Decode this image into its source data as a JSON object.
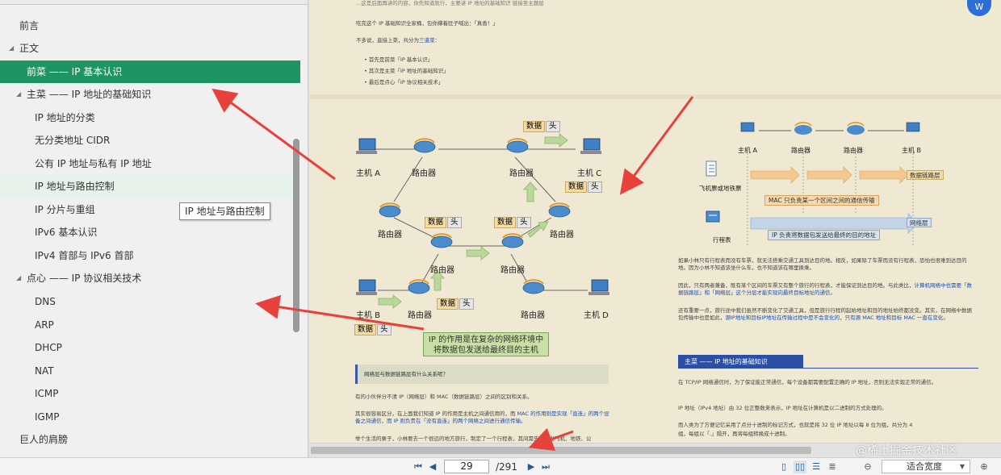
{
  "toc": {
    "items": [
      {
        "label": "前言",
        "level": 0,
        "expanded": null
      },
      {
        "label": "正文",
        "level": 0,
        "expanded": true
      },
      {
        "label": "前菜 —— IP 基本认识",
        "level": 1,
        "expanded": null,
        "active": true
      },
      {
        "label": "主菜 —— IP 地址的基础知识",
        "level": 1,
        "expanded": true
      },
      {
        "label": "IP 地址的分类",
        "level": 2,
        "expanded": null
      },
      {
        "label": "无分类地址 CIDR",
        "level": 2,
        "expanded": null
      },
      {
        "label": "公有 IP 地址与私有 IP 地址",
        "level": 2,
        "expanded": null
      },
      {
        "label": "IP 地址与路由控制",
        "level": 2,
        "expanded": null,
        "hover": true
      },
      {
        "label": "IP 分片与重组",
        "level": 2,
        "expanded": null
      },
      {
        "label": "IPv6 基本认识",
        "level": 2,
        "expanded": null
      },
      {
        "label": "IPv4 首部与 IPv6 首部",
        "level": 2,
        "expanded": null
      },
      {
        "label": "点心 —— IP 协议相关技术",
        "level": 1,
        "expanded": true
      },
      {
        "label": "DNS",
        "level": 2,
        "expanded": null
      },
      {
        "label": "ARP",
        "level": 2,
        "expanded": null
      },
      {
        "label": "DHCP",
        "level": 2,
        "expanded": null
      },
      {
        "label": "NAT",
        "level": 2,
        "expanded": null
      },
      {
        "label": "ICMP",
        "level": 2,
        "expanded": null
      },
      {
        "label": "IGMP",
        "level": 2,
        "expanded": null
      },
      {
        "label": "巨人的肩膀",
        "level": 0,
        "expanded": null
      }
    ],
    "tooltip": "IP 地址与路由控制"
  },
  "page": {
    "intro_line1": "吃完这个 IP 基础知识全家桶，包你撑着肚子喊出：「真香！」",
    "intro_line2_a": "不多说，直接上菜，共分为",
    "intro_line2_b": "三道菜",
    "intro_line2_c": "：",
    "bullets": [
      "首先是前菜「IP 基本认识」",
      "其次是主菜「IP 地址的基础知识」",
      "最后是点心「IP 协议相关技术」"
    ],
    "top_partial": "...这是后面再讲的内容，你先知道就行，主要讲 IP 地址的基础知识 链接至主题层",
    "diagram_left": {
      "nodes": {
        "host_a": "主机 A",
        "host_b": "主机 B",
        "host_c": "主机 C",
        "host_d": "主机 D",
        "router": "路由器"
      },
      "data": "数据",
      "head": "头",
      "callout_line1": "IP 的作用是在复杂的网络环境中",
      "callout_line2": "将数据包发送给最终目的主机"
    },
    "diagram_right": {
      "hosts": [
        "主机 A",
        "路由器",
        "路由器",
        "主机 B"
      ],
      "row1_icon_label": "飞机票或地铁票",
      "row2_icon_label": "行程表",
      "mac_banner": "MAC 只负责某一个区间之间的通信传输",
      "ip_banner": "IP 负责将数据包发送给最终的目的地址",
      "datalink_label": "数据链路层",
      "network_label": "网络层"
    },
    "right_para1": "如果小林只有行程表而没有车票，就无法搭乘交通工具到达目的地。相反，如果除了车票而没有行程表，恐怕也很难到达目的地。因为小林不知道该坐什么车，也不知道该在哪里换乘。",
    "right_para2_a": "因此，只有两者兼备，既有某个区间的车票又有整个旅行的行程表，才能保证到达目的地。与此类比，",
    "right_para2_b": "计算机网络中也需要「数据链路层」和「网络层」这个分层才能实现向最终目标地址的通信。",
    "right_para3_a": "还有重要一点，旅行途中我们虽然不断变化了交通工具，但是旅行行程的起始地址和目的地址始终都没变。其实，在网络中数据包传输中也是如此，",
    "right_para3_b": "源IP地址和目标IP地址在传输过程中是不会变化的，只有源 MAC 地址和目标 MAC 一直在变化。",
    "question": "网络层与数据链路层有什么关系呢？",
    "left_para1": "有的小伙伴分不清 IP（网络层）和 MAC（数据链路层）之间的区别和关系。",
    "left_para2_a": "其实很容易区分，在上面我们知道 IP 的作用是主机之间通信用的，而 ",
    "left_para2_b": "MAC 的作用则是实现「直连」的两个设备之间通信，而 IP 则负责在「没有直连」的两个网络之间进行通信传输。",
    "left_para3": "举个生活的栗子，小林要去一个很远的地方旅行，制定了一个行程表，其间需先后乘坐飞机、地铁、公",
    "section_title": "主菜 —— IP 地址的基础知识",
    "right_para4": "在 TCP/IP 网络通信时，为了保证能正常通信，每个设备都需要配置正确的 IP 地址，否则无法实现正常的通信。",
    "right_para5": "IP 地址（IPv4 地址）由 32 位正整数来表示，IP 地址在计算机是以二进制的方式处理的。",
    "right_para6_a": "而人类为了方便记忆采用了点分十进制的标记方式，也就是将 32 位 IP 地址以每 8 位为组，共分为 4",
    "right_para6_b": "组，每组以「.」隔开，再将每组转换成十进制。"
  },
  "toolbar": {
    "first_page": "⏮",
    "prev_page": "◀",
    "current_page": "29",
    "total_pages": "/291",
    "next_page": "▶",
    "last_page": "⏭",
    "zoom_out": "⊖",
    "zoom_in": "⊕",
    "zoom_value": "适合宽度"
  },
  "watermark": "@稀土掘金技术社区",
  "colors": {
    "accent": "#1d9461",
    "page_bg": "#efe8d2",
    "arrow": "#e8413b",
    "link": "#1a4fb8"
  }
}
